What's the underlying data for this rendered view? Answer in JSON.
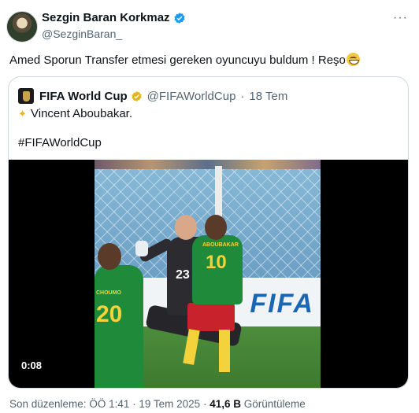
{
  "author": {
    "display_name": "Sezgin Baran Korkmaz",
    "handle": "@SezginBaran_",
    "verified": true
  },
  "tweet": {
    "text": "Amed Sporun Transfer etmesi gereken oyuncuyu buldum ! Reşo",
    "emoji": "grinning-face-icon"
  },
  "quoted": {
    "display_name": "FIFA World Cup",
    "handle": "@FIFAWorldCup",
    "separator": "·",
    "date": "18 Tem",
    "line1": "Vincent Aboubakar.",
    "line2": "#FIFAWorldCup",
    "video": {
      "duration": "0:08",
      "ad_text": "FIFA",
      "players": {
        "keeper_number": "23",
        "striker_number": "10",
        "striker_name": "ABOUBAKAR",
        "teammate_number": "20",
        "teammate_name": "CHOUMO"
      }
    }
  },
  "footer": {
    "edited_label": "Son düzenleme: ÖÖ 1:41",
    "dot": "·",
    "date": "19 Tem 2025",
    "views_count": "41,6 B",
    "views_label": "Görüntüleme"
  },
  "colors": {
    "verified_blue": "#1d9bf0",
    "verified_gold": "#e2b719",
    "text_primary": "#0f1419",
    "text_secondary": "#536471",
    "border": "#cfd9de"
  }
}
